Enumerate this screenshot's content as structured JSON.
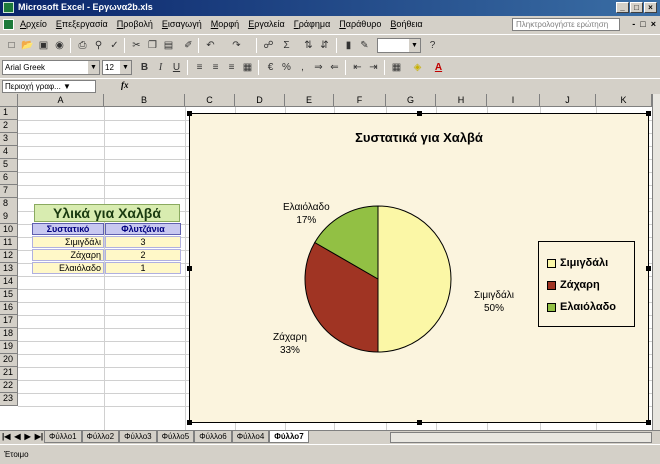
{
  "window": {
    "title": "Microsoft Excel - Εργωνα2b.xls"
  },
  "menu": {
    "items": [
      "Αρχείο",
      "Επεξεργασία",
      "Προβολή",
      "Εισαγωγή",
      "Μορφή",
      "Εργαλεία",
      "Γράφημα",
      "Παράθυρο",
      "Βοήθεια"
    ],
    "help_placeholder": "Πληκτρολογήστε ερώτηση"
  },
  "toolbar": {
    "font_name": "Arial Greek",
    "font_size": "12"
  },
  "formula_bar": {
    "name_box": "Περιοχή γραφ...",
    "fx": "fx"
  },
  "columns": [
    "A",
    "B",
    "C",
    "D",
    "E",
    "F",
    "G",
    "H",
    "I",
    "J",
    "K"
  ],
  "rows": [
    "1",
    "2",
    "3",
    "4",
    "5",
    "6",
    "7",
    "8",
    "9",
    "10",
    "11",
    "12",
    "13",
    "14",
    "15",
    "16",
    "17",
    "18",
    "19",
    "20",
    "21",
    "22",
    "23"
  ],
  "table": {
    "title": "Υλικά για Χαλβά",
    "headers": [
      "Συστατικό",
      "Φλυτζάνια"
    ],
    "rows": [
      {
        "name": "Σιμιγδάλι",
        "value": "3"
      },
      {
        "name": "Ζάχαρη",
        "value": "2"
      },
      {
        "name": "Ελαιόλαδο",
        "value": "1"
      }
    ]
  },
  "chart_data": {
    "type": "pie",
    "title": "Συστατικά για Χαλβά",
    "categories": [
      "Σιμιγδάλι",
      "Ζάχαρη",
      "Ελαιόλαδο"
    ],
    "values": [
      3,
      2,
      1
    ],
    "labels": [
      "Σιμιγδάλι\n50%",
      "Ζάχαρη\n33%",
      "Ελαιόλαδο\n17%"
    ],
    "colors": [
      "#fbf7a6",
      "#a03423",
      "#92c044"
    ],
    "legend": "right"
  },
  "sheet_tabs": [
    "Φύλλο1",
    "Φύλλο2",
    "Φύλλο3",
    "Φύλλο5",
    "Φύλλο6",
    "Φύλλο4",
    "Φύλλο7"
  ],
  "active_sheet": "Φύλλο7",
  "status": "Έτοιμο"
}
